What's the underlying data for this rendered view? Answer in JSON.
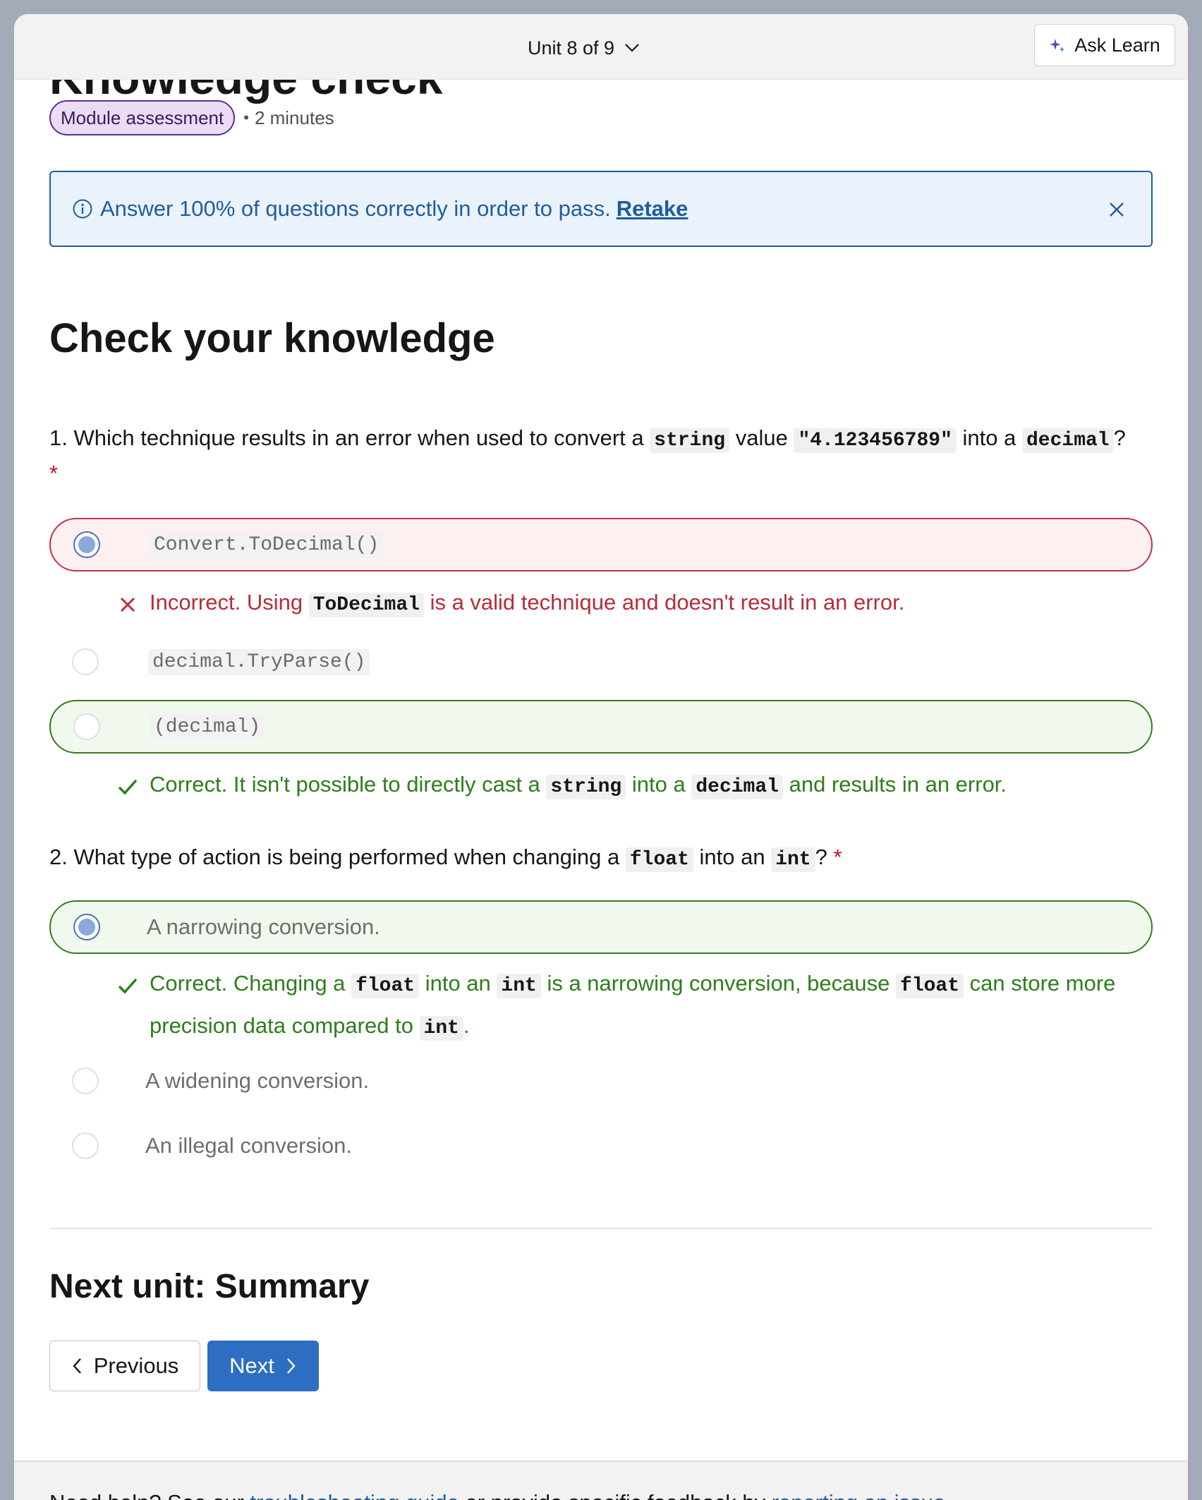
{
  "topbar": {
    "unit_label": "Unit 8 of 9",
    "ask_learn_label": "Ask Learn"
  },
  "header": {
    "title": "Knowledge check",
    "badge": "Module assessment",
    "separator": "•",
    "duration": "2 minutes"
  },
  "alert": {
    "message": "Answer 100% of questions correctly in order to pass.",
    "retake_label": "Retake"
  },
  "section_title": "Check your knowledge",
  "questions": [
    {
      "number": "1.",
      "text_parts": [
        "Which technique results in an error when used to convert a",
        "string",
        "value",
        "\"4.123456789\"",
        "into a",
        "decimal",
        "?"
      ],
      "required": "*",
      "options": [
        {
          "label": "Convert.ToDecimal()",
          "state": "incorrect-selected"
        },
        {
          "label": "decimal.TryParse()",
          "state": "neutral"
        },
        {
          "label": "(decimal)",
          "state": "correct"
        }
      ],
      "feedback_incorrect": [
        "Incorrect. Using",
        "ToDecimal",
        "is a valid technique and doesn't result in an error."
      ],
      "feedback_correct": [
        "Correct. It isn't possible to directly cast a",
        "string",
        "into a",
        "decimal",
        "and results in an error."
      ]
    },
    {
      "number": "2.",
      "text_parts": [
        "What type of action is being performed when changing a",
        "float",
        "into an",
        "int",
        "?"
      ],
      "required": "*",
      "options": [
        {
          "label": "A narrowing conversion.",
          "state": "correct-selected"
        },
        {
          "label": "A widening conversion.",
          "state": "neutral"
        },
        {
          "label": "An illegal conversion.",
          "state": "neutral"
        }
      ],
      "feedback_correct": [
        "Correct. Changing a",
        "float",
        "into an",
        "int",
        "is a narrowing conversion, because",
        "float",
        "can store more precision data compared to",
        "int",
        "."
      ]
    }
  ],
  "next_unit": {
    "title": "Next unit: Summary",
    "previous_label": "Previous",
    "next_label": "Next"
  },
  "footer": {
    "text_start": "Need help? See our",
    "link1": "troubleshooting guide",
    "text_mid": "or provide specific feedback by",
    "link2": "reporting an issue"
  },
  "colors": {
    "accent": "#2d6ec2",
    "correct": "#2e7d1c",
    "incorrect": "#b62d38",
    "badge_bg": "#eadcf5"
  }
}
